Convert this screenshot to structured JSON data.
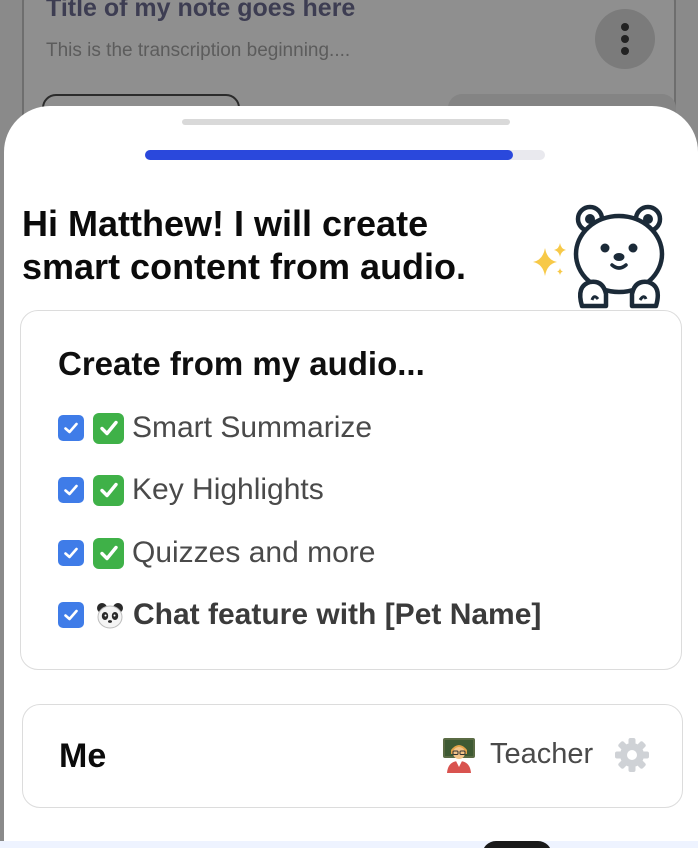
{
  "background": {
    "note_title": "Title of my note goes here",
    "note_preview": "This is the transcription beginning...."
  },
  "sheet": {
    "progress": 0.92,
    "greeting_line1": "Hi Matthew! I will create",
    "greeting_line2": "smart content from audio.",
    "create_card": {
      "title": "Create from my audio...",
      "options": [
        {
          "label": "Smart Summarize",
          "checked": true,
          "emoji": "check-mark-button"
        },
        {
          "label": "Key Highlights",
          "checked": true,
          "emoji": "check-mark-button"
        },
        {
          "label": "Quizzes and more",
          "checked": true,
          "emoji": "check-mark-button"
        },
        {
          "label": "Chat feature with [Pet Name]",
          "checked": true,
          "emoji": "panda"
        }
      ]
    },
    "profile": {
      "name": "Me",
      "role": "Teacher"
    }
  },
  "colors": {
    "accent": "#2a48dc",
    "checkbox": "#3f7ce8",
    "check_emoji": "#3fb148"
  }
}
